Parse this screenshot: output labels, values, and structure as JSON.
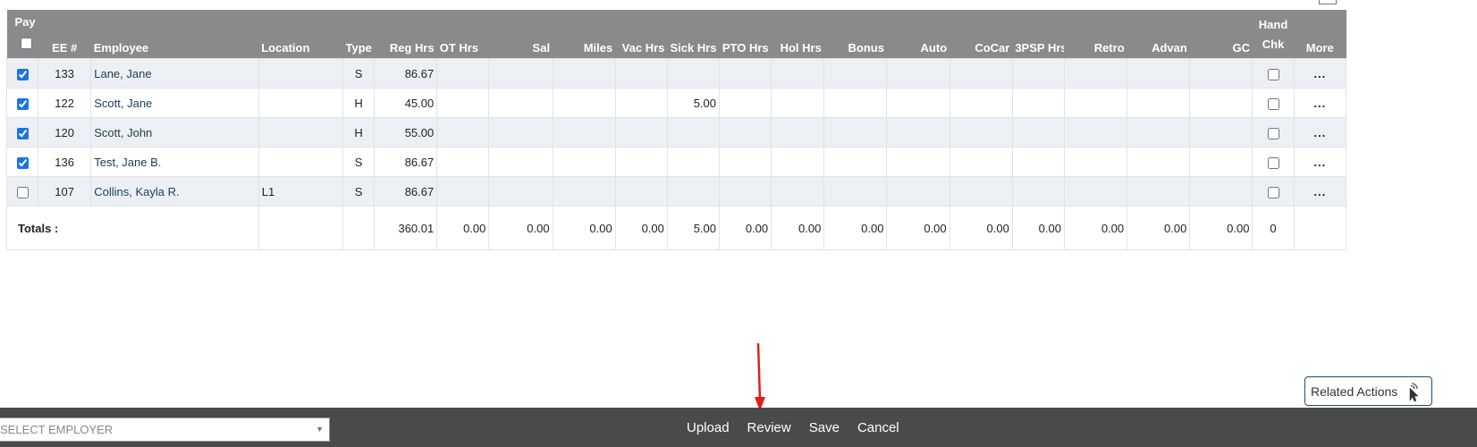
{
  "grid": {
    "headers": {
      "pay": "Pay",
      "ee": "EE #",
      "employee": "Employee",
      "location": "Location",
      "type": "Type",
      "reg": "Reg Hrs",
      "ot": "OT Hrs",
      "sal": "Sal",
      "miles": "Miles",
      "vac": "Vac Hrs",
      "sick": "Sick Hrs",
      "pto": "PTO Hrs",
      "hol": "Hol Hrs",
      "bonus": "Bonus",
      "auto": "Auto",
      "cocar": "CoCar",
      "psp": "3PSP Hrs",
      "retro": "Retro",
      "advan": "Advan",
      "gc": "GC",
      "hand_line1": "Hand",
      "hand_line2": "Chk",
      "more": "More"
    },
    "rows": [
      {
        "checked": true,
        "ee": "133",
        "name": "Lane, Jane",
        "location": "",
        "type": "S",
        "reg": "86.67",
        "sick": "",
        "more": "..."
      },
      {
        "checked": true,
        "ee": "122",
        "name": "Scott, Jane",
        "location": "",
        "type": "H",
        "reg": "45.00",
        "sick": "5.00",
        "more": "..."
      },
      {
        "checked": true,
        "ee": "120",
        "name": "Scott, John",
        "location": "",
        "type": "H",
        "reg": "55.00",
        "sick": "",
        "more": "..."
      },
      {
        "checked": true,
        "ee": "136",
        "name": "Test, Jane B.",
        "location": "",
        "type": "S",
        "reg": "86.67",
        "sick": "",
        "more": "..."
      },
      {
        "checked": false,
        "ee": "107",
        "name": "Collins, Kayla R.",
        "location": "L1",
        "type": "S",
        "reg": "86.67",
        "sick": "",
        "more": "..."
      }
    ],
    "totals": {
      "label": "Totals :",
      "reg": "360.01",
      "ot": "0.00",
      "sal": "0.00",
      "miles": "0.00",
      "vac": "0.00",
      "sick": "5.00",
      "pto": "0.00",
      "hol": "0.00",
      "bonus": "0.00",
      "auto": "0.00",
      "cocar": "0.00",
      "psp": "0.00",
      "retro": "0.00",
      "advan": "0.00",
      "gc": "0.00",
      "hand": "0"
    }
  },
  "related_actions": {
    "label": "Related Actions",
    "icon": "pointer-hand-icon"
  },
  "bottom_bar": {
    "employer_placeholder": "SELECT EMPLOYER",
    "actions": {
      "upload": "Upload",
      "review": "Review",
      "save": "Save",
      "cancel": "Cancel"
    }
  },
  "colors": {
    "header_bg": "#8a8a8a",
    "row_alt_bg": "#ecf0f4",
    "bottom_bar_bg": "#4a4a4a",
    "checkbox_accent": "#1a73e8",
    "annotation_arrow": "#e0201b"
  }
}
